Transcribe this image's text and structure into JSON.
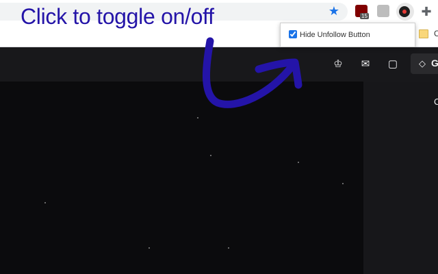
{
  "annotation": {
    "caption": "Click to toggle on/off"
  },
  "browser": {
    "toolbar": {
      "bookmark_star_icon": "star-icon",
      "extensions": [
        {
          "name": "ublock-extension",
          "badge": "15"
        },
        {
          "name": "gray-extension"
        },
        {
          "name": "record-extension",
          "active": true
        }
      ],
      "puzzle_icon": "puzzle-icon"
    },
    "bookmarks_bar": {
      "item_label": "C"
    }
  },
  "popup": {
    "checkbox_checked": true,
    "checkbox_label": "Hide Unfollow Button"
  },
  "page": {
    "nav_icons": [
      "crown-icon",
      "inbox-icon",
      "chat-icon",
      "diamond-icon"
    ],
    "get_label": "G",
    "sidebar_letter": "C"
  },
  "colors": {
    "annotation": "#2414a8",
    "page_bg": "#0e0e10",
    "nav_bg": "#18181b",
    "accent": "#1a73e8"
  }
}
